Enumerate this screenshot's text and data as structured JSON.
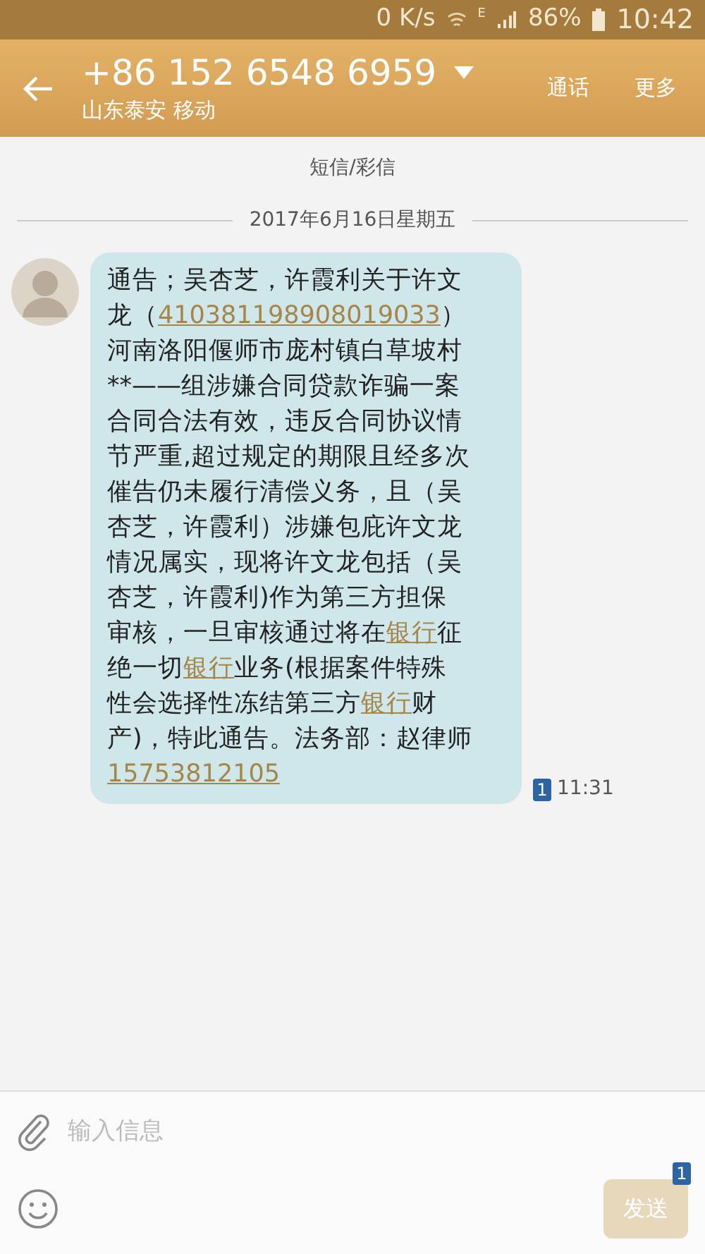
{
  "status_bar": {
    "speed": "0 K/s",
    "network": "E",
    "battery": "86%",
    "time": "10:42"
  },
  "header": {
    "number": "+86 152 6548 6959",
    "location": "山东泰安 移动",
    "actions": [
      "通话",
      "更多"
    ]
  },
  "channel_label": "短信/彩信",
  "date": "2017年6月16日星期五",
  "message": {
    "lines": [
      [
        {
          "text": "通告；吴杏芝，许霞利关于许文",
          "link": false
        }
      ],
      [
        {
          "text": "龙（",
          "link": false
        },
        {
          "text": "410381198908019033",
          "link": true
        },
        {
          "text": "）",
          "link": false
        }
      ],
      [
        {
          "text": "河南洛阳偃师市庞村镇白草坡村",
          "link": false
        }
      ],
      [
        {
          "text": "**——组涉嫌合同贷款诈骗一案",
          "link": false
        }
      ],
      [
        {
          "text": "合同合法有效，违反合同协议情",
          "link": false
        }
      ],
      [
        {
          "text": "节严重,超过规定的期限且经多次",
          "link": false
        }
      ],
      [
        {
          "text": "催告仍未履行清偿义务，且（吴",
          "link": false
        }
      ],
      [
        {
          "text": "杏芝，许霞利）涉嫌包庇许文龙",
          "link": false
        }
      ],
      [
        {
          "text": "情况属实，现将许文龙包括（吴",
          "link": false
        }
      ],
      [
        {
          "text": "杏芝，许霞利)作为第三方担保",
          "link": false
        }
      ],
      [
        {
          "text": "审核，一旦审核通过将在",
          "link": false
        },
        {
          "text": "银行",
          "link": true
        },
        {
          "text": "征",
          "link": false
        }
      ],
      [
        {
          "text": "绝一切",
          "link": false
        },
        {
          "text": "银行",
          "link": true
        },
        {
          "text": "业务(根据案件特殊",
          "link": false
        }
      ],
      [
        {
          "text": "性会选择性冻结第三方",
          "link": false
        },
        {
          "text": "银行",
          "link": true
        },
        {
          "text": "财",
          "link": false
        }
      ],
      [
        {
          "text": "产)，特此通告。法务部：赵律师",
          "link": false
        }
      ],
      [
        {
          "text": "15753812105",
          "link": true
        }
      ]
    ],
    "sim": "1",
    "time": "11:31"
  },
  "composer": {
    "placeholder": "输入信息",
    "send": "发送",
    "send_disabled": true,
    "sim": "1"
  }
}
